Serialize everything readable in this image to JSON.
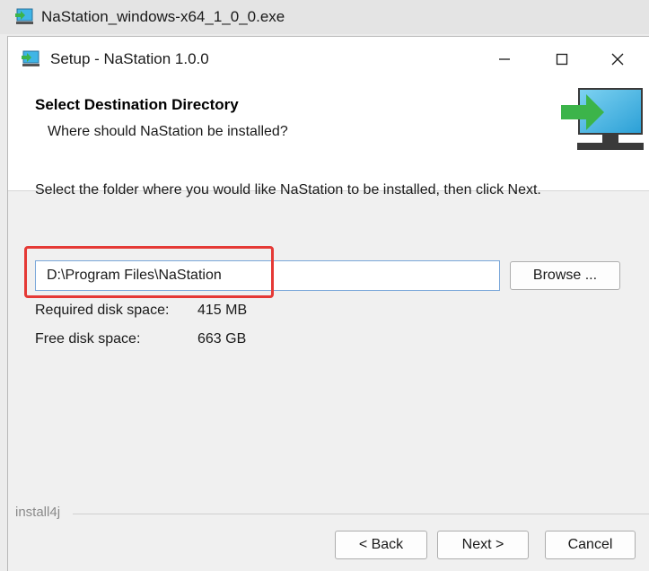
{
  "outer_window": {
    "title": "NaStation_windows-x64_1_0_0.exe"
  },
  "window": {
    "title": "Setup - NaStation 1.0.0",
    "controls": {
      "minimize": "—",
      "maximize": "☐",
      "close": "✕"
    }
  },
  "header": {
    "title": "Select Destination Directory",
    "subtitle": "Where should NaStation be installed?"
  },
  "body": {
    "instruction": "Select the folder where you would like NaStation to be installed, then click Next.",
    "path_value": "D:\\Program Files\\NaStation",
    "browse_label": "Browse ...",
    "required_label": "Required disk space:",
    "required_value": "415 MB",
    "free_label": "Free disk space:",
    "free_value": "663 GB"
  },
  "footer": {
    "brand": "install4j",
    "back_label": "< Back",
    "next_label": "Next >",
    "cancel_label": "Cancel"
  },
  "colors": {
    "highlight": "#e53935",
    "installer_green": "#3cb44a",
    "monitor_blue": "#3fb5e6"
  },
  "icons": {
    "app": "installer-icon",
    "header": "computer-install-icon"
  }
}
